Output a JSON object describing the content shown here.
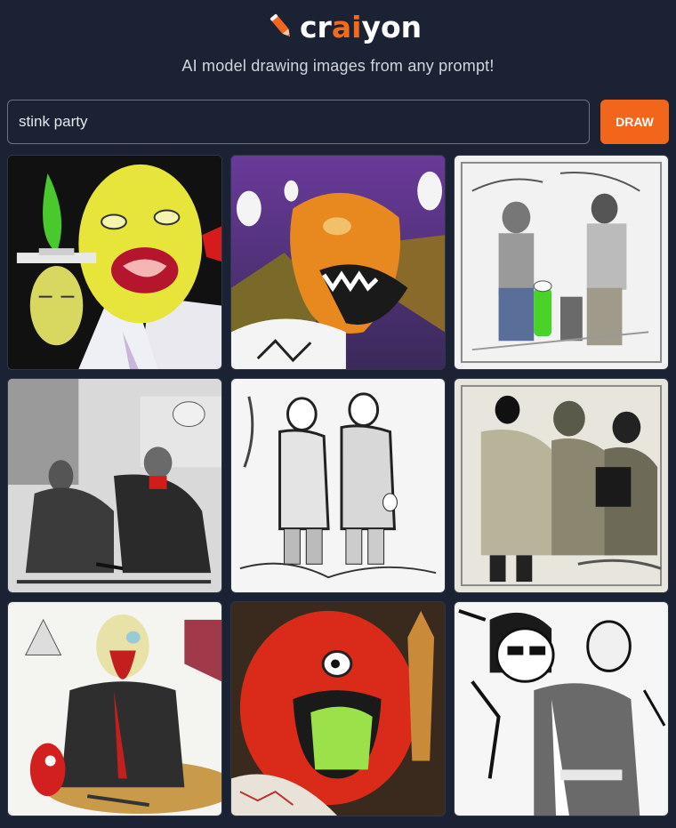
{
  "app": {
    "logo_prefix": "cr",
    "logo_ai": "ai",
    "logo_suffix": "yon",
    "tagline": "AI model drawing images from any prompt!",
    "accent_color": "#f2661c"
  },
  "search": {
    "value": "stink party",
    "button_label": "DRAW"
  },
  "results": {
    "count": 9,
    "images": [
      {
        "icon": "generated-image"
      },
      {
        "icon": "generated-image"
      },
      {
        "icon": "generated-image"
      },
      {
        "icon": "generated-image"
      },
      {
        "icon": "generated-image"
      },
      {
        "icon": "generated-image"
      },
      {
        "icon": "generated-image"
      },
      {
        "icon": "generated-image"
      },
      {
        "icon": "generated-image"
      }
    ]
  }
}
